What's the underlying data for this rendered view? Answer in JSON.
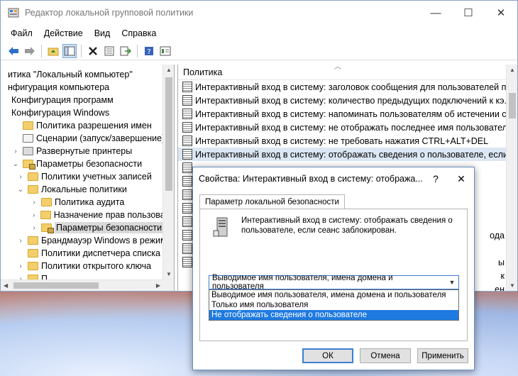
{
  "window": {
    "title": "Редактор локальной групповой политики",
    "minimize": "—",
    "maximize": "☐",
    "close": "✕"
  },
  "menu": [
    "Файл",
    "Действие",
    "Вид",
    "Справка"
  ],
  "tree": [
    {
      "label": "итика \"Локальный компьютер\"",
      "indent": 0,
      "arrow": "",
      "icon": "none"
    },
    {
      "label": "нфигурация компьютера",
      "indent": 0,
      "arrow": "",
      "icon": "none"
    },
    {
      "label": "Конфигурация программ",
      "indent": 1,
      "arrow": "",
      "icon": "none"
    },
    {
      "label": "Конфигурация Windows",
      "indent": 1,
      "arrow": "",
      "icon": "none"
    },
    {
      "label": "Политика разрешения имен",
      "indent": 1,
      "arrow": "",
      "icon": "folder"
    },
    {
      "label": "Сценарии (запуск/завершение)",
      "indent": 1,
      "arrow": "",
      "icon": "script"
    },
    {
      "label": "Развернутые принтеры",
      "indent": 1,
      "arrow": "›",
      "icon": "printer"
    },
    {
      "label": "Параметры безопасности",
      "indent": 1,
      "arrow": "⌄",
      "icon": "lockfolder"
    },
    {
      "label": "Политики учетных записей",
      "indent": 2,
      "arrow": "›",
      "icon": "folder"
    },
    {
      "label": "Локальные политики",
      "indent": 2,
      "arrow": "⌄",
      "icon": "folder"
    },
    {
      "label": "Политика аудита",
      "indent": 3,
      "arrow": "›",
      "icon": "folder"
    },
    {
      "label": "Назначение прав пользовате",
      "indent": 3,
      "arrow": "›",
      "icon": "folder"
    },
    {
      "label": "Параметры безопасности",
      "indent": 3,
      "arrow": "›",
      "icon": "lockfolder",
      "selected": true
    },
    {
      "label": "Брандмауэр Windows в режим",
      "indent": 2,
      "arrow": "›",
      "icon": "folder"
    },
    {
      "label": "Политики диспетчера списка се",
      "indent": 2,
      "arrow": "",
      "icon": "folder"
    },
    {
      "label": "Политики открытого ключа",
      "indent": 2,
      "arrow": "›",
      "icon": "folder"
    },
    {
      "label": "П",
      "indent": 2,
      "arrow": "›",
      "icon": "folder"
    }
  ],
  "list": {
    "header": "Политика",
    "rows": [
      "Интерактивный вход в систему: заголовок сообщения для пользователей п...",
      "Интерактивный вход в систему: количество предыдущих подключений к кэ...",
      "Интерактивный вход в систему: напоминать пользователям об истечении с...",
      "Интерактивный вход в систему: не отображать последнее имя пользователя",
      "Интерактивный вход в систему: не требовать нажатия CTRL+ALT+DEL",
      "Интерактивный вход в систему: отображать сведения о пользователе, если ..."
    ],
    "selected_index": 5,
    "hidden_row_count": 8,
    "clipped_right": [
      "ода",
      "",
      "ы",
      "к",
      "ен",
      "",
      "ение",
      "",
      "л",
      "S"
    ]
  },
  "dialog": {
    "title": "Свойства: Интерактивный вход в систему: отобража...",
    "help": "?",
    "close": "✕",
    "tab": "Параметр локальной безопасности",
    "description": "Интерактивный вход в систему: отображать сведения о пользователе, если сеанс заблокирован.",
    "combo_value": "Выводимое имя пользователя, имена домена и пользователя",
    "options": [
      "Выводимое имя пользователя, имена домена и пользователя",
      "Только имя пользователя",
      "Не отображать сведения о пользователе"
    ],
    "highlighted_option": 2,
    "buttons": {
      "ok": "ОК",
      "cancel": "Отмена",
      "apply": "Применить"
    }
  }
}
